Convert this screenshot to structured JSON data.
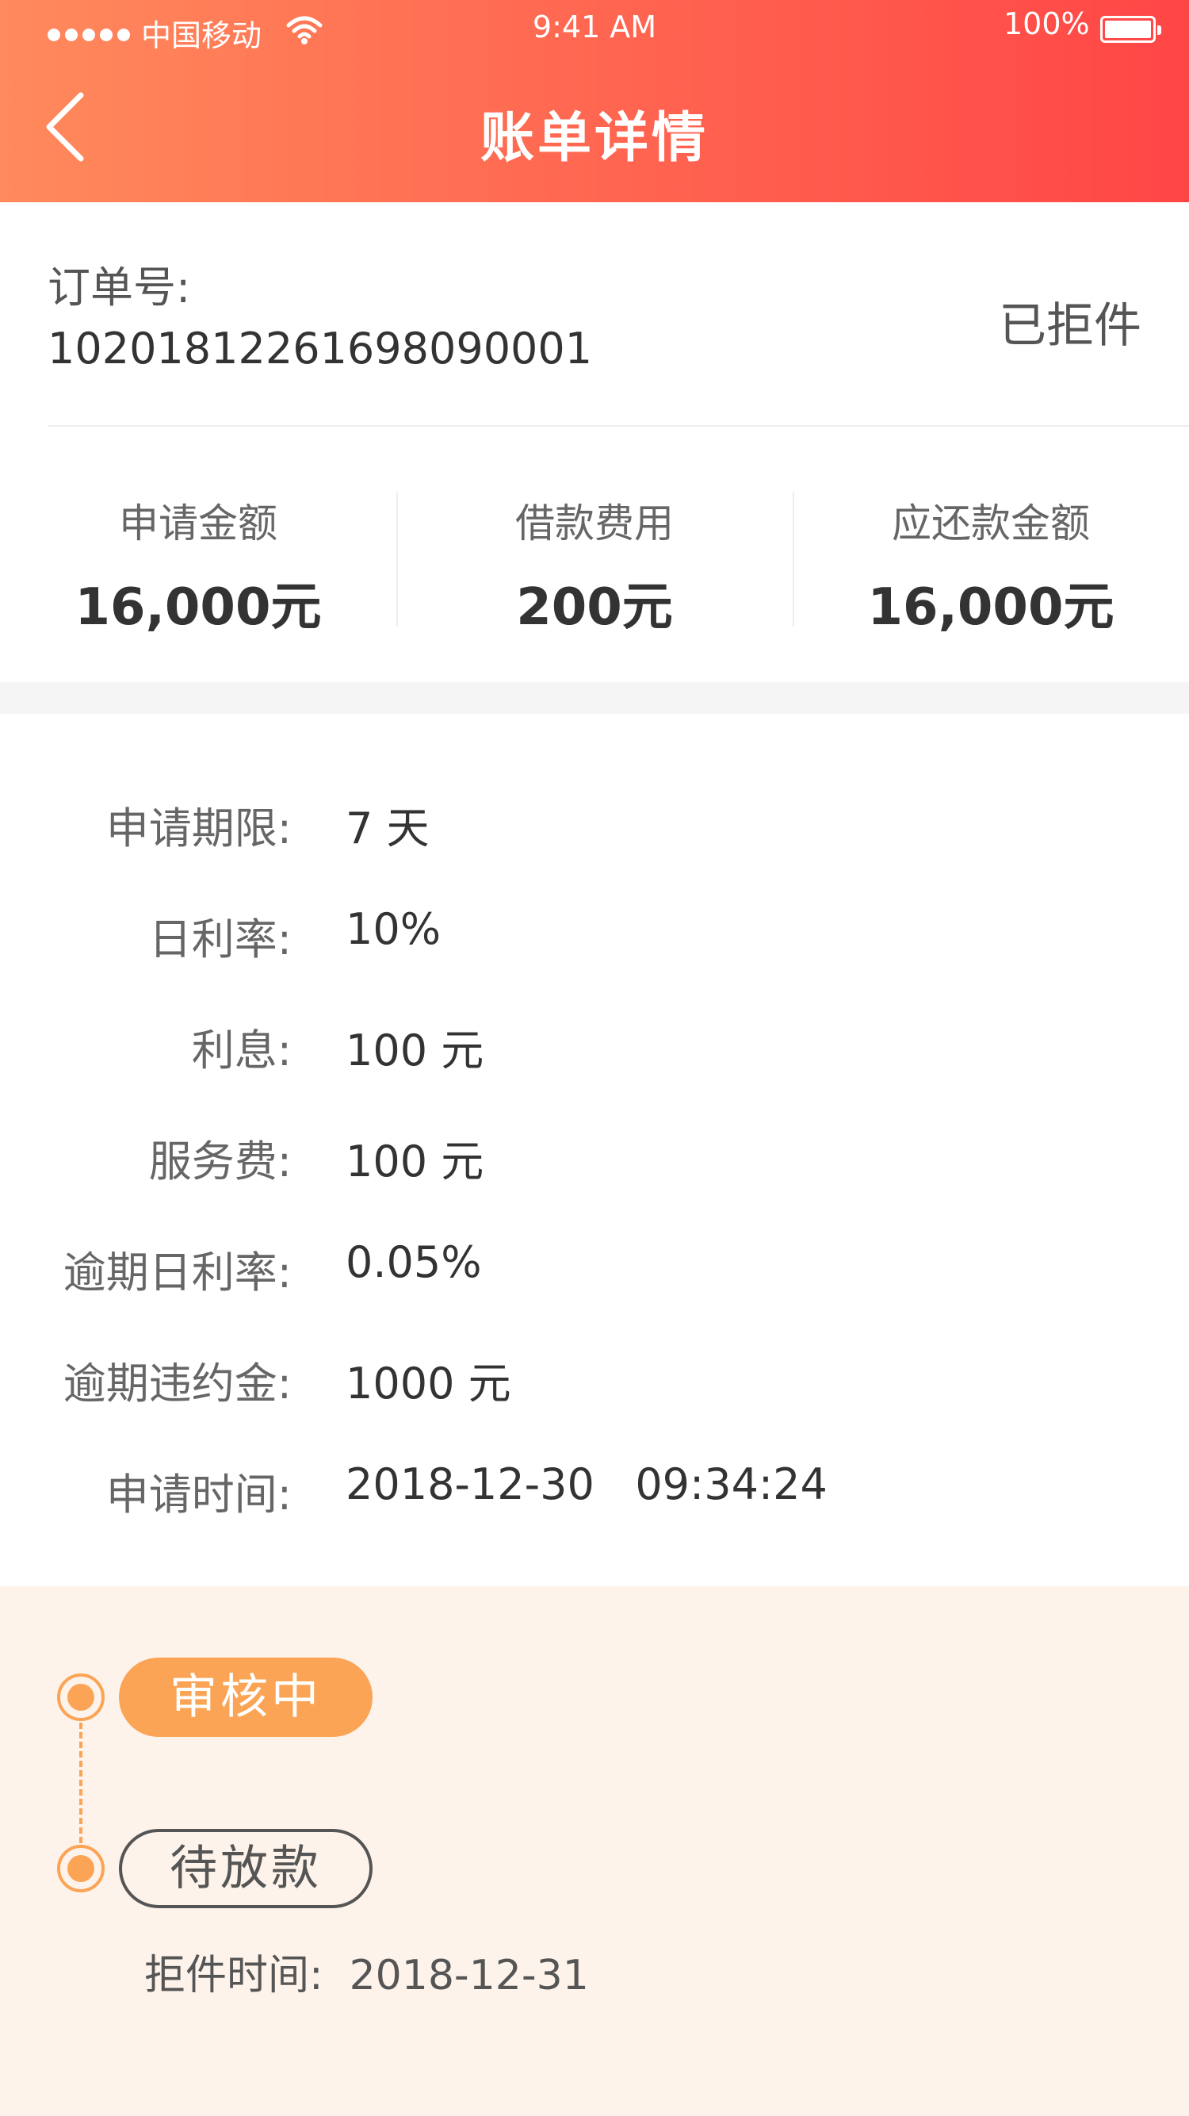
{
  "status_bar": {
    "carrier": "中国移动",
    "time": "9:41 AM",
    "battery": "100%"
  },
  "header": {
    "title": "账单详情"
  },
  "order": {
    "label": "订单号:",
    "number": "1020181226169809000​1",
    "status": "已拒件"
  },
  "summary": [
    {
      "label": "申请金额",
      "value": "16,000元"
    },
    {
      "label": "借款费用",
      "value": "200元"
    },
    {
      "label": "应还款金额",
      "value": "16,000元"
    }
  ],
  "details": [
    {
      "label": "申请期限:",
      "value": "7 天"
    },
    {
      "label": "日利率:",
      "value": "10%"
    },
    {
      "label": "利息:",
      "value": "100 元"
    },
    {
      "label": "服务费:",
      "value": "100 元"
    },
    {
      "label": "逾期日利率:",
      "value": "0.05%"
    },
    {
      "label": "逾期违约金:",
      "value": "1000 元"
    },
    {
      "label": "申请时间:",
      "value": "2018-12-30   09:34:24"
    }
  ],
  "timeline": {
    "step1": "审核中",
    "step2": "待放款",
    "reject_label": "拒件时间:",
    "reject_date": "2018-12-31"
  }
}
